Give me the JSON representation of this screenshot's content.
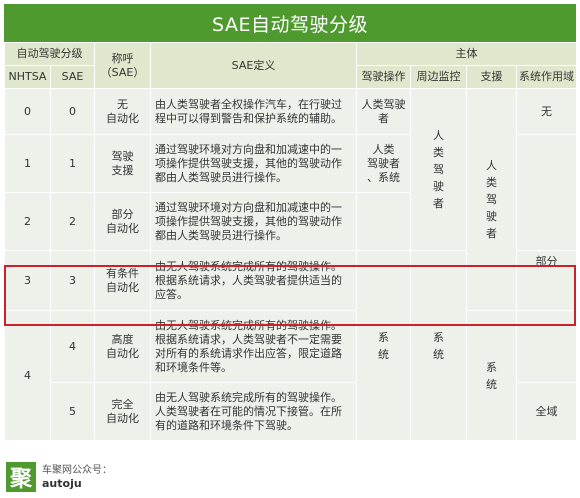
{
  "title": "SAE自动驾驶分级",
  "headers": {
    "level_group": "自动驾驶分级",
    "nhtsa": "NHTSA",
    "sae": "SAE",
    "name": "称呼\n（SAE）",
    "definition": "SAE定义",
    "subject": "主体",
    "driving_op": "驾驶操作",
    "monitoring": "周边监控",
    "support": "支援",
    "domain": "系统作用域"
  },
  "rows": [
    {
      "nhtsa": "0",
      "sae": "0",
      "name": "无\n自动化",
      "def": "由人类驾驶者全权操作汽车，在行驶过程中可以得到警告和保护系统的辅助。"
    },
    {
      "nhtsa": "1",
      "sae": "1",
      "name": "驾驶\n支援",
      "def": "通过驾驶环境对方向盘和加减速中的一项操作提供驾驶支援，其他的驾驶动作都由人类驾驶员进行操作。"
    },
    {
      "nhtsa": "2",
      "sae": "2",
      "name": "部分\n自动化",
      "def": "通过驾驶环境对方向盘和加减速中的一项操作提供驾驶支援，其他的驾驶动作都由人类驾驶员进行操作。"
    },
    {
      "nhtsa": "3",
      "sae": "3",
      "name": "有条件\n自动化",
      "def": "由无人驾驶系统完成所有的驾驶操作。根据系统请求，人类驾驶者提供适当的应答。"
    },
    {
      "nhtsa": "4",
      "sae": "4",
      "name": "高度\n自动化",
      "def": "由无人驾驶系统完成所有的驾驶操作。根据系统请求，人类驾驶者不一定需要对所有的系统请求作出应答，限定道路和环境条件等。"
    },
    {
      "nhtsa": "",
      "sae": "5",
      "name": "完全\n自动化",
      "def": "由无人驾驶系统完成所有的驾驶操作。人类驾驶者在可能的情况下接管。在所有的道路和环境条件下驾驶。"
    }
  ],
  "cells": {
    "op_human": "人类驾驶\n者",
    "op_human_sys": "人类\n驾驶者\n、系统",
    "op_system": "系\n统",
    "mon_human": "人\n类\n驾\n驶\n者",
    "mon_system": "系\n统",
    "sup_human": "人\n类\n驾\n驶\n者",
    "sup_system": "系\n统",
    "dom_none": "无",
    "dom_partial": "部分",
    "dom_full": "全域"
  },
  "brand": {
    "logo": "聚",
    "line1": "车聚网公众号：",
    "line2": "autoju"
  },
  "colors": {
    "header_green": "#4e9a2e",
    "sub_header": "#dfe8cd",
    "row_gray": "#eef0ea",
    "highlight_red": "#c8232c"
  }
}
